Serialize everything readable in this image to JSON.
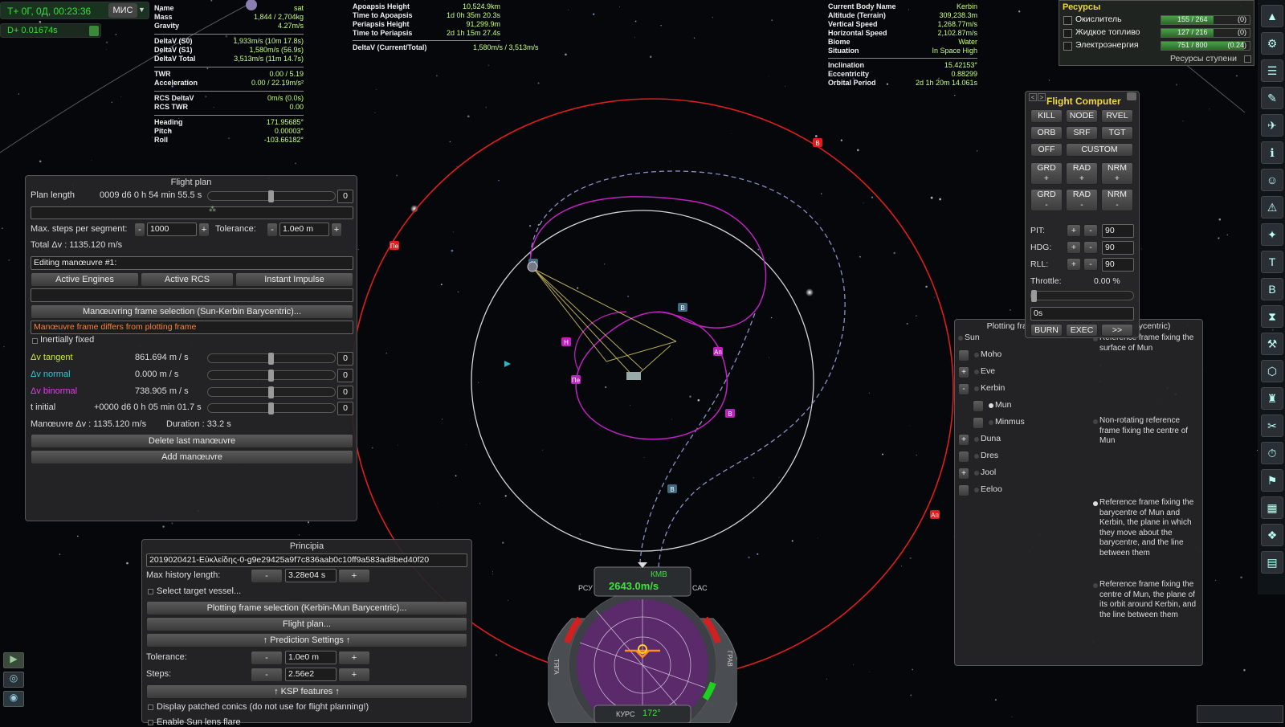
{
  "met": {
    "clock": "T+ 0Г, 0Д, 00:23:36",
    "mode": "МИС",
    "delta": "D+ 0.01674s"
  },
  "vessel": {
    "name_k": "Name",
    "name_v": "sat",
    "mass_k": "Mass",
    "mass_v": "1,844 / 2,704kg",
    "grav_k": "Gravity",
    "grav_v": "4.27m/s",
    "dv0_k": "DeltaV (S0)",
    "dv0_v": "1,933m/s (10m 17.8s)",
    "dv1_k": "DeltaV (S1)",
    "dv1_v": "1,580m/s (56.9s)",
    "dvt_k": "DeltaV Total",
    "dvt_v": "3,513m/s (11m 14.7s)",
    "twr_k": "TWR",
    "twr_v": "0.00 / 5.19",
    "acc_k": "Acceleration",
    "acc_v": "0.00 / 22.19m/s²",
    "rcsdv_k": "RCS DeltaV",
    "rcsdv_v": "0m/s (0.0s)",
    "rcstwr_k": "RCS TWR",
    "rcstwr_v": "0.00",
    "hdg_k": "Heading",
    "hdg_v": "171.95685°",
    "pitch_k": "Pitch",
    "pitch_v": "0.00003°",
    "roll_k": "Roll",
    "roll_v": "-103.66182°"
  },
  "orbit": {
    "ap_k": "Apoapsis Height",
    "ap_v": "10,524.9km",
    "tap_k": "Time to Apoapsis",
    "tap_v": "1d 0h 35m 20.3s",
    "pe_k": "Periapsis Height",
    "pe_v": "91,299.9m",
    "tpe_k": "Time to Periapsis",
    "tpe_v": "2d 1h 15m 27.4s",
    "dv_k": "DeltaV (Current/Total)",
    "dv_v": "1,580m/s / 3,513m/s"
  },
  "surface": {
    "body_k": "Current Body Name",
    "body_v": "Kerbin",
    "alt_k": "Altitude (Terrain)",
    "alt_v": "309,238.3m",
    "vs_k": "Vertical Speed",
    "vs_v": "1,268.77m/s",
    "hs_k": "Horizontal Speed",
    "hs_v": "2,102.87m/s",
    "biome_k": "Biome",
    "biome_v": "Water",
    "sit_k": "Situation",
    "sit_v": "In Space High",
    "inc_k": "Inclination",
    "inc_v": "15.42153°",
    "ecc_k": "Eccentricity",
    "ecc_v": "0.88299",
    "per_k": "Orbital Period",
    "per_v": "2d 1h 20m 14.061s"
  },
  "resources": {
    "title": "Ресурсы",
    "items": [
      {
        "name": "Окислитель",
        "value": "155 / 264",
        "extra": "(0)",
        "fill": 0.587
      },
      {
        "name": "Жидкое топливо",
        "value": "127 / 216",
        "extra": "(0)",
        "fill": 0.588
      },
      {
        "name": "Электроэнергия",
        "value": "751 / 800",
        "extra": "(0.24)",
        "fill": 0.939
      }
    ],
    "stage_label": "Ресурсы ступени"
  },
  "flight_plan": {
    "title": "Flight plan",
    "plan_length_label": "Plan length",
    "plan_length_value": "0009 d6 0 h 54 min 55.5 s",
    "zero": "0",
    "max_steps_label": "Max. steps per segment:",
    "max_steps_value": "1000",
    "tolerance_label": "Tolerance:",
    "tolerance_value": "1.0e0 m",
    "minus": "-",
    "plus": "+",
    "total_dv": "Total Δv : 1135.120 m/s",
    "editing": "Editing manœuvre #1:",
    "active_engines": "Active Engines",
    "active_rcs": "Active RCS",
    "instant_impulse": "Instant Impulse",
    "frame_selection": "Manœuvring frame selection (Sun-Kerbin Barycentric)...",
    "frame_warning": "Manœuvre frame differs from plotting frame",
    "inertially_fixed": "Inertially fixed",
    "dv_tangent_label": "Δv tangent",
    "dv_tangent_value": "861.694 m / s",
    "dv_normal_label": "Δv normal",
    "dv_normal_value": "0.000 m / s",
    "dv_binormal_label": "Δv binormal",
    "dv_binormal_value": "738.905 m / s",
    "t_initial_label": "t initial",
    "t_initial_value": "+0000 d6 0 h 05 min 01.7 s",
    "maneuver_dv": "Manœuvre Δv : 1135.120 m/s",
    "duration": "Duration : 33.2 s",
    "delete_label": "Delete last manœuvre",
    "add_label": "Add manœuvre",
    "colors": {
      "tangent": "#c8e830",
      "normal": "#30c8e0",
      "binormal": "#e040e0",
      "warning": "#ff8030"
    }
  },
  "principia": {
    "title": "Principia",
    "version": "2019020421-Εὐκλείδης-0-g9e29425a9f7c836aab0c10ff9a583ad8bed40f20",
    "max_history_label": "Max history length:",
    "max_history_value": "3.28e04 s",
    "select_target": "Select target vessel...",
    "plotting_frame": "Plotting frame selection (Kerbin-Mun Barycentric)...",
    "flight_plan_btn": "Flight plan...",
    "prediction_settings": "↑ Prediction Settings ↑",
    "tolerance_label": "Tolerance:",
    "tolerance_value": "1.0e0 m",
    "steps_label": "Steps:",
    "steps_value": "2.56e2",
    "ksp_features": "↑ KSP features ↑",
    "patched_conics": "Display patched conics (do not use for flight planning!)",
    "sun_lens": "Enable Sun lens flare",
    "minus": "-",
    "plus": "+"
  },
  "flight_computer": {
    "title": "Flight Computer",
    "row1": [
      "KILL",
      "NODE",
      "RVEL"
    ],
    "row2": [
      "ORB",
      "SRF",
      "TGT"
    ],
    "off": "OFF",
    "custom": "CUSTOM",
    "row3": [
      "GRD\n+",
      "RAD\n+",
      "NRM\n+"
    ],
    "row4": [
      "GRD\n-",
      "RAD\n-",
      "NRM\n-"
    ],
    "pit_label": "PIT:",
    "pit_value": "90",
    "hdg_label": "HDG:",
    "hdg_value": "90",
    "rll_label": "RLL:",
    "rll_value": "90",
    "throttle_label": "Throttle:",
    "throttle_value": "0.00 %",
    "time_value": "0s",
    "burn": "BURN",
    "exec": "EXEC",
    "more": ">>",
    "nav": [
      "<",
      ">"
    ]
  },
  "plotting_frame": {
    "title": "Plotting frame selection (Kerbin-Mun Barycentric)",
    "bodies": [
      {
        "name": "Sun",
        "indent": 0,
        "exp": ""
      },
      {
        "name": "Moho",
        "indent": 1,
        "exp": ""
      },
      {
        "name": "Eve",
        "indent": 1,
        "exp": "+"
      },
      {
        "name": "Kerbin",
        "indent": 1,
        "exp": "-"
      },
      {
        "name": "Mun",
        "indent": 2,
        "exp": "",
        "selected": true
      },
      {
        "name": "Minmus",
        "indent": 2,
        "exp": ""
      },
      {
        "name": "Duna",
        "indent": 1,
        "exp": "+"
      },
      {
        "name": "Dres",
        "indent": 1,
        "exp": ""
      },
      {
        "name": "Jool",
        "indent": 1,
        "exp": "+"
      },
      {
        "name": "Eeloo",
        "indent": 1,
        "exp": ""
      }
    ],
    "descriptions": [
      "Reference frame fixing the surface of Mun",
      "Non-rotating reference frame fixing the centre of Mun",
      "Reference frame fixing the barycentre of Mun and Kerbin, the plane in which they move about the barycentre, and the line between them",
      "Reference frame fixing the centre of Mun, the plane of its orbit around Kerbin, and the line between them"
    ]
  },
  "navball": {
    "mode": "КМВ",
    "speed": "2643.0m/s",
    "heading_label": "КУРС",
    "heading": "172°",
    "left_label": "РСУ",
    "right_label": "САС",
    "gear_left": "ТЯГА",
    "gear_right": "ГРАВ"
  },
  "markers": {
    "ap1": "Ап",
    "pe1": "Пе",
    "ap2": "Ап",
    "pe2": "Пе",
    "h": "Н",
    "b": "В"
  },
  "colors": {
    "orbit_red": "#e01c1c",
    "orbit_magenta": "#c020c0",
    "orbit_dashed": "#8890c8",
    "orbit_white": "#d8d8d8",
    "accent_green": "#2fcf2f",
    "label_green": "#c8ff7a"
  }
}
